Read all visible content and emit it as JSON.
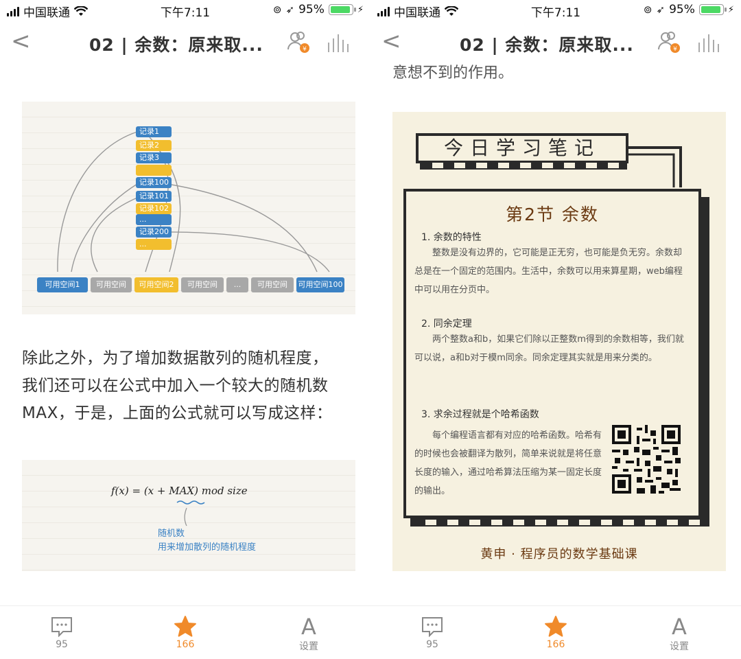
{
  "status": {
    "carrier": "中国联通",
    "time": "下午7:11",
    "battery": "95%"
  },
  "nav": {
    "title": "02 | 余数：原来取...",
    "back_icon": "chevron-left-icon",
    "people_icon": "people-coin-icon",
    "stats_icon": "audio-bars-icon"
  },
  "left": {
    "diagram": {
      "records": [
        "记录1",
        "记录2",
        "记录3",
        "",
        "记录100",
        "记录101",
        "记录102",
        "...",
        "记录200",
        "..."
      ],
      "slots": [
        "可用空间1",
        "可用空间",
        "可用空间2",
        "可用空间",
        "...",
        "可用空间",
        "可用空间100"
      ]
    },
    "paragraph": [
      "除此之外，为了增加数据散列的随机程度，",
      "我们还可以在公式中加入一个较大的随机数",
      "MAX，于是，上面的公式就可以写成这样："
    ],
    "formula": {
      "expr": "f(x) = (x + MAX) mod size",
      "note1": "随机数",
      "note2": "用来增加散列的随机程度"
    }
  },
  "right": {
    "partial_line": "意想不到的作用。",
    "note": {
      "heading": "今日学习笔记",
      "section": "第2节  余数",
      "items": [
        {
          "h": "1. 余数的特性",
          "t": "整数是没有边界的，它可能是正无穷，也可能是负无穷。余数却总是在一个固定的范围内。生活中，余数可以用来算星期，web编程中可以用在分页中。"
        },
        {
          "h": "2. 同余定理",
          "t": "两个整数a和b，如果它们除以正整数m得到的余数相等，我们就可以说，a和b对于模m同余。同余定理其实就是用来分类的。"
        },
        {
          "h": "3. 求余过程就是个哈希函数",
          "t": "每个编程语言都有对应的哈希函数。哈希有的时候也会被翻译为散列，简单来说就是将任意长度的输入，通过哈希算法压缩为某一固定长度的输出。"
        }
      ],
      "footer": "黄申 · 程序员的数学基础课"
    }
  },
  "tabbar": {
    "comments_count": "95",
    "likes_count": "166",
    "settings_label": "设置"
  },
  "colors": {
    "accent": "#f08a2a",
    "record_blue": "#3b82c4",
    "record_yellow": "#f2be2e",
    "slot_gray": "#a8a8a8",
    "note_bg": "#f6f1e0",
    "note_brown": "#6b3a12"
  }
}
